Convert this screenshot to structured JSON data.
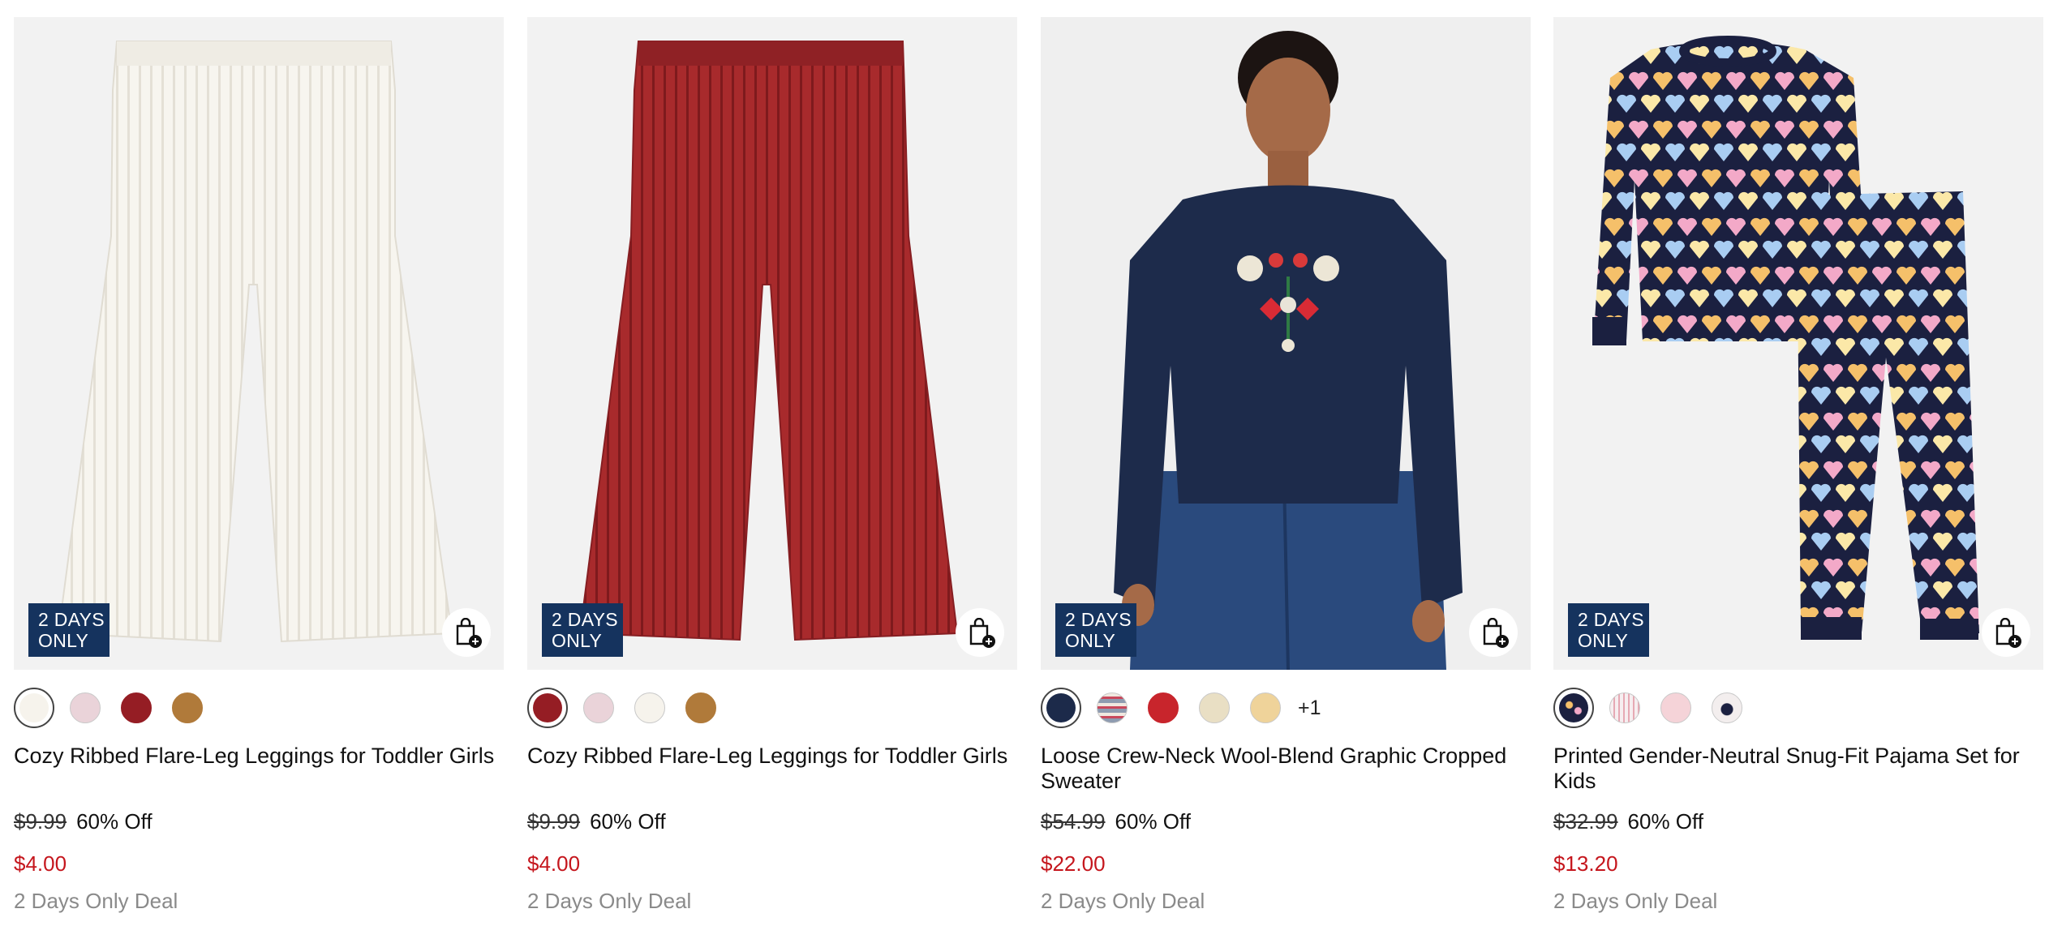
{
  "products": [
    {
      "badge_line1": "2 DAYS",
      "badge_line2": "ONLY",
      "title": "Cozy Ribbed Flare-Leg Leggings for Toddler Girls",
      "original_price": "$9.99",
      "discount": "60% Off",
      "sale_price": "$4.00",
      "deal_text": "2 Days Only Deal",
      "image": "cream-ribbed-flare-leggings",
      "swatches": [
        "#f6f3ec",
        "#ead3d9",
        "#951d24",
        "#b07a3a"
      ],
      "selected_swatch": 0,
      "more_colors": ""
    },
    {
      "badge_line1": "2 DAYS",
      "badge_line2": "ONLY",
      "title": "Cozy Ribbed Flare-Leg Leggings for Toddler Girls",
      "original_price": "$9.99",
      "discount": "60% Off",
      "sale_price": "$4.00",
      "deal_text": "2 Days Only Deal",
      "image": "red-ribbed-flare-leggings",
      "swatches": [
        "#951d24",
        "#ead3d9",
        "#f6f3ec",
        "#b07a3a"
      ],
      "selected_swatch": 0,
      "more_colors": ""
    },
    {
      "badge_line1": "2 DAYS",
      "badge_line2": "ONLY",
      "title": "Loose Crew-Neck Wool-Blend Graphic Cropped Sweater",
      "original_price": "$54.99",
      "discount": "60% Off",
      "sale_price": "$22.00",
      "deal_text": "2 Days Only Deal",
      "image": "navy-graphic-sweater-model",
      "swatches": [
        "#1c2a4a",
        "#8e9bb0",
        "#c8252c",
        "#e9dfc4",
        "#efd39a"
      ],
      "selected_swatch": 0,
      "more_colors": "+1"
    },
    {
      "badge_line1": "2 DAYS",
      "badge_line2": "ONLY",
      "title": "Printed Gender-Neutral Snug-Fit Pajama Set for Kids",
      "original_price": "$32.99",
      "discount": "60% Off",
      "sale_price": "$13.20",
      "deal_text": "2 Days Only Deal",
      "image": "heart-print-pajama-set",
      "swatches": [
        "#1b2040",
        "#e6a9b4",
        "#f5d3d8",
        "#f3eeee"
      ],
      "selected_swatch": 0,
      "more_colors": ""
    }
  ],
  "colors": {
    "badge_bg": "#15335e",
    "sale_price": "#c5161d",
    "deal_text": "#8a8a8a",
    "image_bg": "#f2f2f2"
  },
  "icons": {
    "add_to_bag": "shopping-bag-plus-icon"
  }
}
